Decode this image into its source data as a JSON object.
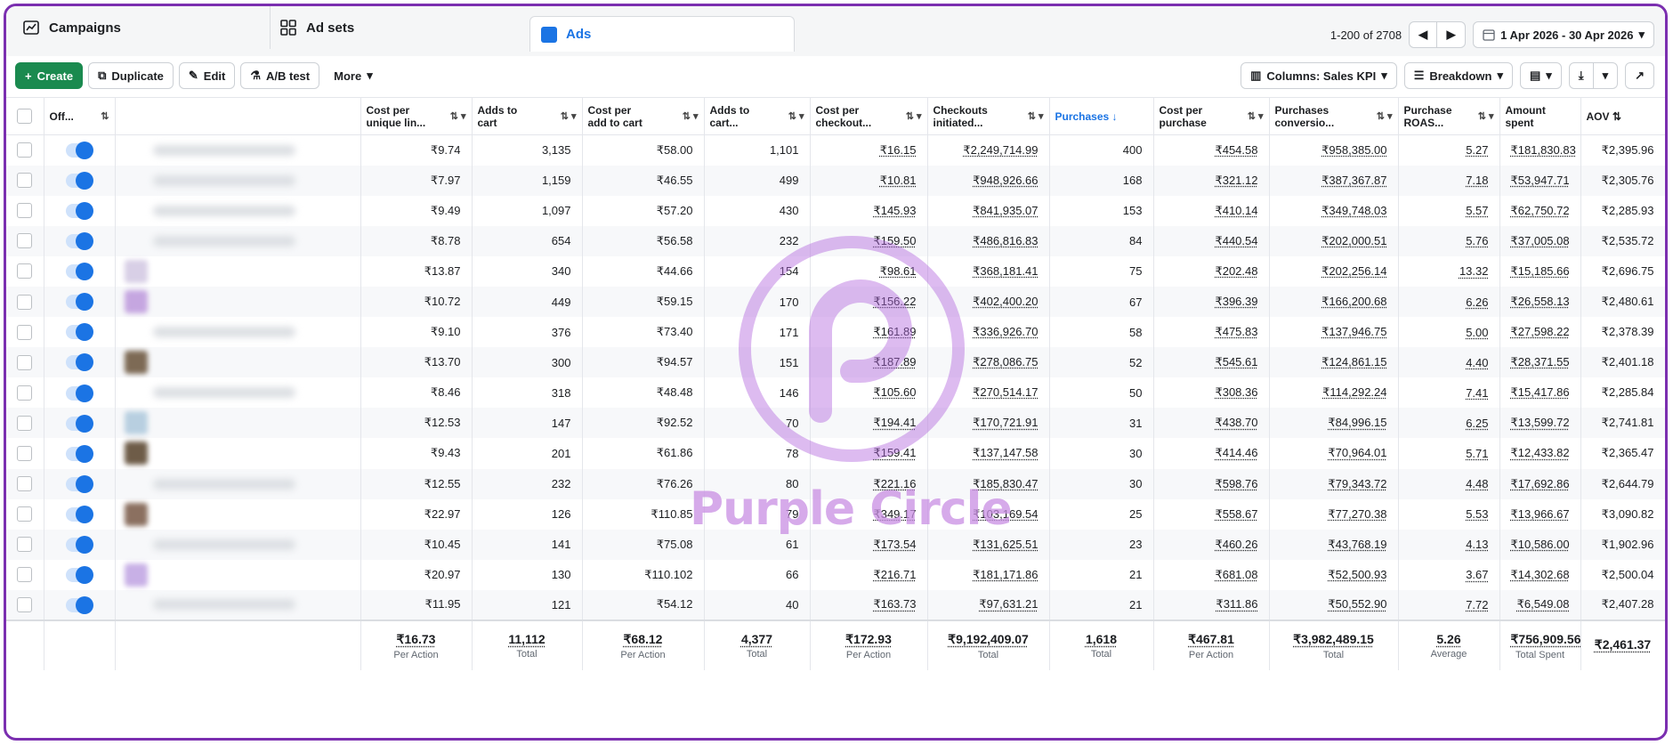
{
  "tabs": {
    "campaigns": "Campaigns",
    "adsets": "Ad sets",
    "ads": "Ads"
  },
  "pager": {
    "range": "1-200 of 2708",
    "date": "1 Apr 2026 - 30 Apr 2026"
  },
  "toolbar": {
    "create": "Create",
    "duplicate": "Duplicate",
    "edit": "Edit",
    "ab_test": "A/B test",
    "more": "More",
    "columns": "Columns: Sales KPI",
    "breakdown": "Breakdown"
  },
  "headers": {
    "off": "Off...",
    "cpu": [
      "Cost per",
      "unique lin..."
    ],
    "atc": [
      "Adds to",
      "cart"
    ],
    "cpatc": [
      "Cost per",
      "add to cart"
    ],
    "atcv": [
      "Adds to",
      "cart..."
    ],
    "cpco": [
      "Cost per",
      "checkout..."
    ],
    "coi": [
      "Checkouts",
      "initiated..."
    ],
    "purch": "Purchases",
    "cpp": [
      "Cost per",
      "purchase"
    ],
    "pcv": [
      "Purchases",
      "conversio..."
    ],
    "roas": [
      "Purchase",
      "ROAS..."
    ],
    "spent": [
      "Amount",
      "spent"
    ],
    "aov": "AOV"
  },
  "rows": [
    [
      "₹9.74",
      "3,135",
      "₹58.00",
      "1,101",
      "₹16.15",
      "₹2,249,714.99",
      "400",
      "₹454.58",
      "₹958,385.00",
      "5.27",
      "₹181,830.83",
      "₹2,395.96"
    ],
    [
      "₹7.97",
      "1,159",
      "₹46.55",
      "499",
      "₹10.81",
      "₹948,926.66",
      "168",
      "₹321.12",
      "₹387,367.87",
      "7.18",
      "₹53,947.71",
      "₹2,305.76"
    ],
    [
      "₹9.49",
      "1,097",
      "₹57.20",
      "430",
      "₹145.93",
      "₹841,935.07",
      "153",
      "₹410.14",
      "₹349,748.03",
      "5.57",
      "₹62,750.72",
      "₹2,285.93"
    ],
    [
      "₹8.78",
      "654",
      "₹56.58",
      "232",
      "₹159.50",
      "₹486,816.83",
      "84",
      "₹440.54",
      "₹202,000.51",
      "5.76",
      "₹37,005.08",
      "₹2,535.72"
    ],
    [
      "₹13.87",
      "340",
      "₹44.66",
      "154",
      "₹98.61",
      "₹368,181.41",
      "75",
      "₹202.48",
      "₹202,256.14",
      "13.32",
      "₹15,185.66",
      "₹2,696.75"
    ],
    [
      "₹10.72",
      "449",
      "₹59.15",
      "170",
      "₹156.22",
      "₹402,400.20",
      "67",
      "₹396.39",
      "₹166,200.68",
      "6.26",
      "₹26,558.13",
      "₹2,480.61"
    ],
    [
      "₹9.10",
      "376",
      "₹73.40",
      "171",
      "₹161.89",
      "₹336,926.70",
      "58",
      "₹475.83",
      "₹137,946.75",
      "5.00",
      "₹27,598.22",
      "₹2,378.39"
    ],
    [
      "₹13.70",
      "300",
      "₹94.57",
      "151",
      "₹187.89",
      "₹278,086.75",
      "52",
      "₹545.61",
      "₹124,861.15",
      "4.40",
      "₹28,371.55",
      "₹2,401.18"
    ],
    [
      "₹8.46",
      "318",
      "₹48.48",
      "146",
      "₹105.60",
      "₹270,514.17",
      "50",
      "₹308.36",
      "₹114,292.24",
      "7.41",
      "₹15,417.86",
      "₹2,285.84"
    ],
    [
      "₹12.53",
      "147",
      "₹92.52",
      "70",
      "₹194.41",
      "₹170,721.91",
      "31",
      "₹438.70",
      "₹84,996.15",
      "6.25",
      "₹13,599.72",
      "₹2,741.81"
    ],
    [
      "₹9.43",
      "201",
      "₹61.86",
      "78",
      "₹159.41",
      "₹137,147.58",
      "30",
      "₹414.46",
      "₹70,964.01",
      "5.71",
      "₹12,433.82",
      "₹2,365.47"
    ],
    [
      "₹12.55",
      "232",
      "₹76.26",
      "80",
      "₹221.16",
      "₹185,830.47",
      "30",
      "₹598.76",
      "₹79,343.72",
      "4.48",
      "₹17,692.86",
      "₹2,644.79"
    ],
    [
      "₹22.97",
      "126",
      "₹110.85",
      "79",
      "₹349.17",
      "₹103,169.54",
      "25",
      "₹558.67",
      "₹77,270.38",
      "5.53",
      "₹13,966.67",
      "₹3,090.82"
    ],
    [
      "₹10.45",
      "141",
      "₹75.08",
      "61",
      "₹173.54",
      "₹131,625.51",
      "23",
      "₹460.26",
      "₹43,768.19",
      "4.13",
      "₹10,586.00",
      "₹1,902.96"
    ],
    [
      "₹20.97",
      "130",
      "₹110.102",
      "66",
      "₹216.71",
      "₹181,171.86",
      "21",
      "₹681.08",
      "₹52,500.93",
      "3.67",
      "₹14,302.68",
      "₹2,500.04"
    ],
    [
      "₹11.95",
      "121",
      "₹54.12",
      "40",
      "₹163.73",
      "₹97,631.21",
      "21",
      "₹311.86",
      "₹50,552.90",
      "7.72",
      "₹6,549.08",
      "₹2,407.28"
    ]
  ],
  "thumb_colors": [
    "",
    "",
    "",
    "",
    "#d8cfe6",
    "#c5a6e0",
    "",
    "#7d6a55",
    "",
    "#b8cfe0",
    "#6e5c48",
    "",
    "#8b7060",
    "",
    "#c8b0e6",
    ""
  ],
  "totals": [
    {
      "v": "₹16.73",
      "l": "Per Action"
    },
    {
      "v": "11,112",
      "l": "Total"
    },
    {
      "v": "₹68.12",
      "l": "Per Action"
    },
    {
      "v": "4,377",
      "l": "Total"
    },
    {
      "v": "₹172.93",
      "l": "Per Action"
    },
    {
      "v": "₹9,192,409.07",
      "l": "Total"
    },
    {
      "v": "1,618",
      "l": "Total"
    },
    {
      "v": "₹467.81",
      "l": "Per Action"
    },
    {
      "v": "₹3,982,489.15",
      "l": "Total"
    },
    {
      "v": "5.26",
      "l": "Average"
    },
    {
      "v": "₹756,909.56",
      "l": "Total Spent"
    },
    {
      "v": "₹2,461.37",
      "l": ""
    }
  ],
  "watermark": {
    "text": "Purple Circle",
    "color": "#c98ee3"
  },
  "colors": {
    "accent": "#1b74e4",
    "create": "#1a8a4f",
    "border": "#7b2fb0"
  }
}
